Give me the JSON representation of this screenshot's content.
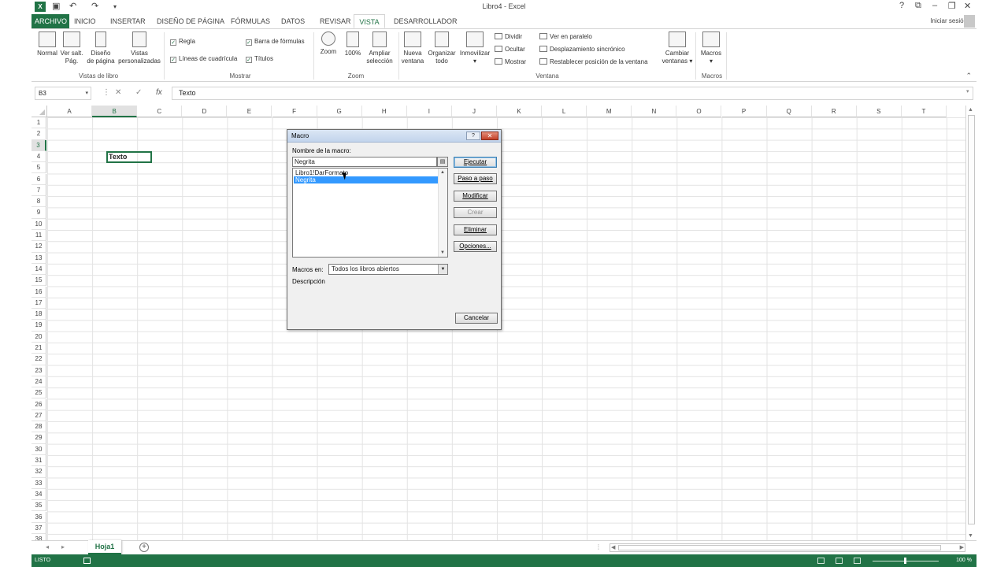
{
  "window": {
    "title": "Libro4 - Excel",
    "signin": "Iniciar sesión",
    "app_icon": "excel-icon",
    "qa_icons": [
      "save-icon",
      "undo-icon",
      "redo-icon",
      "customize-icon"
    ],
    "controls": [
      "help-icon",
      "ribbon-display-icon",
      "minimize-icon",
      "restore-icon",
      "close-icon"
    ]
  },
  "ribbon": {
    "tabs": [
      "ARCHIVO",
      "INICIO",
      "INSERTAR",
      "DISEÑO DE PÁGINA",
      "FÓRMULAS",
      "DATOS",
      "REVISAR",
      "VISTA",
      "DESARROLLADOR"
    ],
    "active_tab": "VISTA",
    "groups": {
      "views": {
        "label": "Vistas de libro",
        "normal": "Normal",
        "pagebreak_1": "Ver salt.",
        "pagebreak_2": "Pág.",
        "layout_1": "Diseño",
        "layout_2": "de página",
        "custom_1": "Vistas",
        "custom_2": "personalizadas"
      },
      "show": {
        "label": "Mostrar",
        "ruler": "Regla",
        "gridlines": "Líneas de cuadrícula",
        "formulabar": "Barra de fórmulas",
        "headings": "Títulos"
      },
      "zoom": {
        "label": "Zoom",
        "zoom": "Zoom",
        "hundred": "100%",
        "sel_1": "Ampliar",
        "sel_2": "selección"
      },
      "window": {
        "label": "Ventana",
        "new_1": "Nueva",
        "new_2": "ventana",
        "arrange_1": "Organizar",
        "arrange_2": "todo",
        "freeze": "Inmovilizar",
        "split": "Dividir",
        "hide": "Ocultar",
        "unhide": "Mostrar",
        "side": "Ver en paralelo",
        "sync": "Desplazamiento sincrónico",
        "reset": "Restablecer posición de la ventana",
        "switch_1": "Cambiar",
        "switch_2": "ventanas"
      },
      "macros": {
        "label": "Macros",
        "macros": "Macros"
      }
    }
  },
  "formula_bar": {
    "namebox": "B3",
    "content": "Texto"
  },
  "grid": {
    "columns": [
      "A",
      "B",
      "C",
      "D",
      "E",
      "F",
      "G",
      "H",
      "I",
      "J",
      "K",
      "L",
      "M",
      "N",
      "O",
      "P",
      "Q",
      "R",
      "S",
      "T"
    ],
    "rows": [
      "1",
      "2",
      "3",
      "4",
      "5",
      "6",
      "7",
      "8",
      "9",
      "10",
      "11",
      "12",
      "13",
      "14",
      "15",
      "16",
      "17",
      "18",
      "19",
      "20",
      "21",
      "22",
      "23",
      "24",
      "25",
      "26",
      "27",
      "28",
      "29",
      "30",
      "31",
      "32",
      "33",
      "34",
      "35",
      "36",
      "37",
      "38"
    ],
    "selected_col": "B",
    "selected_row": "3",
    "active_cell_value": "Texto"
  },
  "sheets": {
    "tabs": [
      "Hoja1"
    ]
  },
  "status": {
    "mode": "LISTO",
    "zoom": "100 %"
  },
  "dialog": {
    "title": "Macro",
    "name_label": "Nombre de la macro:",
    "name_value": "Negrita",
    "list": [
      "Libro1!DarFormato",
      "Negrita"
    ],
    "selected": "Negrita",
    "buttons": {
      "run": "Ejecutar",
      "step": "Paso a paso",
      "edit": "Modificar",
      "create": "Crear",
      "delete": "Eliminar",
      "options": "Opciones...",
      "cancel": "Cancelar"
    },
    "macros_in_label": "Macros en:",
    "macros_in_value": "Todos los libros abiertos",
    "description_label": "Descripción"
  }
}
